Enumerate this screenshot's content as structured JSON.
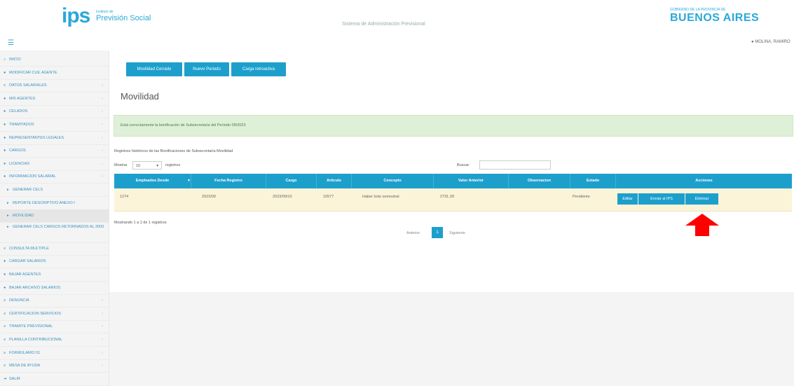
{
  "header": {
    "logo_text": "ips",
    "logo_sub_small": "Instituto de",
    "logo_sub": "Previsión Social",
    "system_title": "Sistema de Administración Previsional",
    "gob_small": "GOBIERNO DE LA PROVINCIA DE",
    "gob_big": "BUENOS AIRES",
    "user": "MOLINA, RAMIRO",
    "brand_color": "#2aa8d8"
  },
  "sidebar": {
    "items": [
      {
        "icon": "home-icon",
        "label": "INICIO"
      },
      {
        "icon": "user-icon",
        "label": "MODIFICAR CUIL AGENTE"
      },
      {
        "icon": "list-icon",
        "label": "DATOS SALARIALES"
      },
      {
        "icon": "user-icon",
        "label": "MIS AGENTES"
      },
      {
        "icon": "user-icon",
        "label": "CELADOS"
      },
      {
        "icon": "user-icon",
        "label": "TRAMITADOS"
      },
      {
        "icon": "user-icon",
        "label": "REPRESENTANTES LEGALES"
      },
      {
        "icon": "user-icon",
        "label": "CARGOS"
      },
      {
        "icon": "user-icon",
        "label": "LICENCIAS"
      },
      {
        "icon": "user-icon",
        "label": "INFORMACION SALARIAL"
      },
      {
        "icon": "arrow-icon",
        "label": "GENERAR CELS"
      },
      {
        "icon": "arrow-icon",
        "label": "REPORTE DESCRIPTIVO ANEXO I"
      },
      {
        "icon": "arrow-icon",
        "label": "MOVILIDAD"
      },
      {
        "icon": "arrow-icon",
        "label": "GENERAR CELS CARGOS RETORNADOS AL 2003"
      },
      {
        "icon": "list-icon",
        "label": "CONSULTA MULTIPLE"
      },
      {
        "icon": "user-icon",
        "label": "CARGAR SALARIOS"
      },
      {
        "icon": "user-icon",
        "label": "BAJAR AGENTES"
      },
      {
        "icon": "user-icon",
        "label": "BAJAR ARCHIVO SALARIOS"
      },
      {
        "icon": "list-icon",
        "label": "DENUNCIA"
      },
      {
        "icon": "list-icon",
        "label": "CERTIFICACION SERVICIOS"
      },
      {
        "icon": "list-icon",
        "label": "TRAMITE PREVISIONAL"
      },
      {
        "icon": "list-icon",
        "label": "PLANILLA CONTRIBUCIONAL"
      },
      {
        "icon": "list-icon",
        "label": "FORMULARIO 51"
      },
      {
        "icon": "list-icon",
        "label": "MESA DE AYUDA"
      },
      {
        "icon": "exit-icon",
        "label": "SALIR"
      }
    ]
  },
  "toolbar": {
    "btn1": "Movilidad Cerrado",
    "btn2": "Nuevo Periodo",
    "btn3": "Carga retroactiva"
  },
  "page": {
    "title": "Movilidad",
    "alert": "Está correctamente la bonificación de Subsecretaría del Período 09/2023",
    "subtitle": "Registros históricos de las Bonificaciones de Subsecretaría Movilidad",
    "show_label": "Mostrar",
    "show_value": "10",
    "records_label": "registros",
    "search_label": "Buscar:",
    "info": "Mostrando 1 a 1 de 1 registros",
    "prev": "Anterior",
    "page_num": "1",
    "next": "Siguiente"
  },
  "table": {
    "headers": [
      "Empleados Desde",
      "Fecha Registro",
      "Cargo",
      "Artículo",
      "Concepto",
      "Valor Anterior",
      "Observacion",
      "Estado",
      "Acciones"
    ],
    "row": [
      "1274",
      "2023/09",
      "2023/09/10",
      "10577",
      "Haber boto semestral",
      "2731.28",
      "",
      "Pendiente"
    ],
    "actions": [
      "Editar",
      "Enviar al IPS",
      "Eliminar"
    ]
  },
  "accent_color": "#1d9fcc",
  "annotation_color": "#ff0000"
}
